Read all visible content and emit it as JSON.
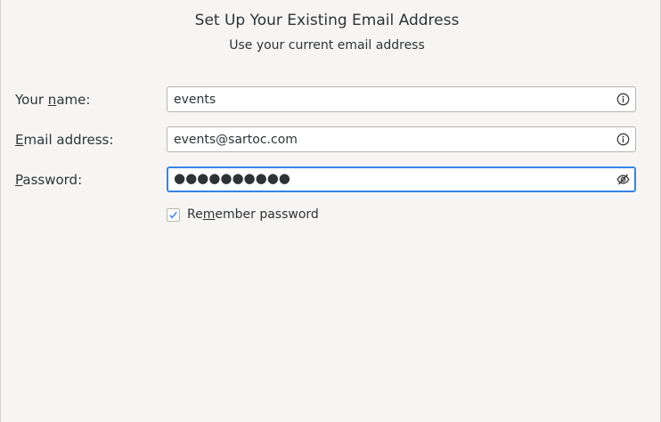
{
  "header": {
    "title": "Set Up Your Existing Email Address",
    "subtitle": "Use your current email address"
  },
  "form": {
    "name": {
      "label_pre": "Your ",
      "label_accel": "n",
      "label_post": "ame:",
      "value": "events",
      "icon": "info-icon"
    },
    "email": {
      "label_pre": "",
      "label_accel": "E",
      "label_post": "mail address:",
      "value": "events@sartoc.com",
      "icon": "info-icon"
    },
    "password": {
      "label_pre": "",
      "label_accel": "P",
      "label_post": "assword:",
      "masked_value": "●●●●●●●●●●",
      "icon": "eye-slash-icon"
    },
    "remember": {
      "label_pre": "Re",
      "label_accel": "m",
      "label_post": "ember password",
      "checked": true
    }
  },
  "colors": {
    "background": "#f6f5f4",
    "focus_accent": "#3584e4",
    "text": "#2e3436"
  }
}
